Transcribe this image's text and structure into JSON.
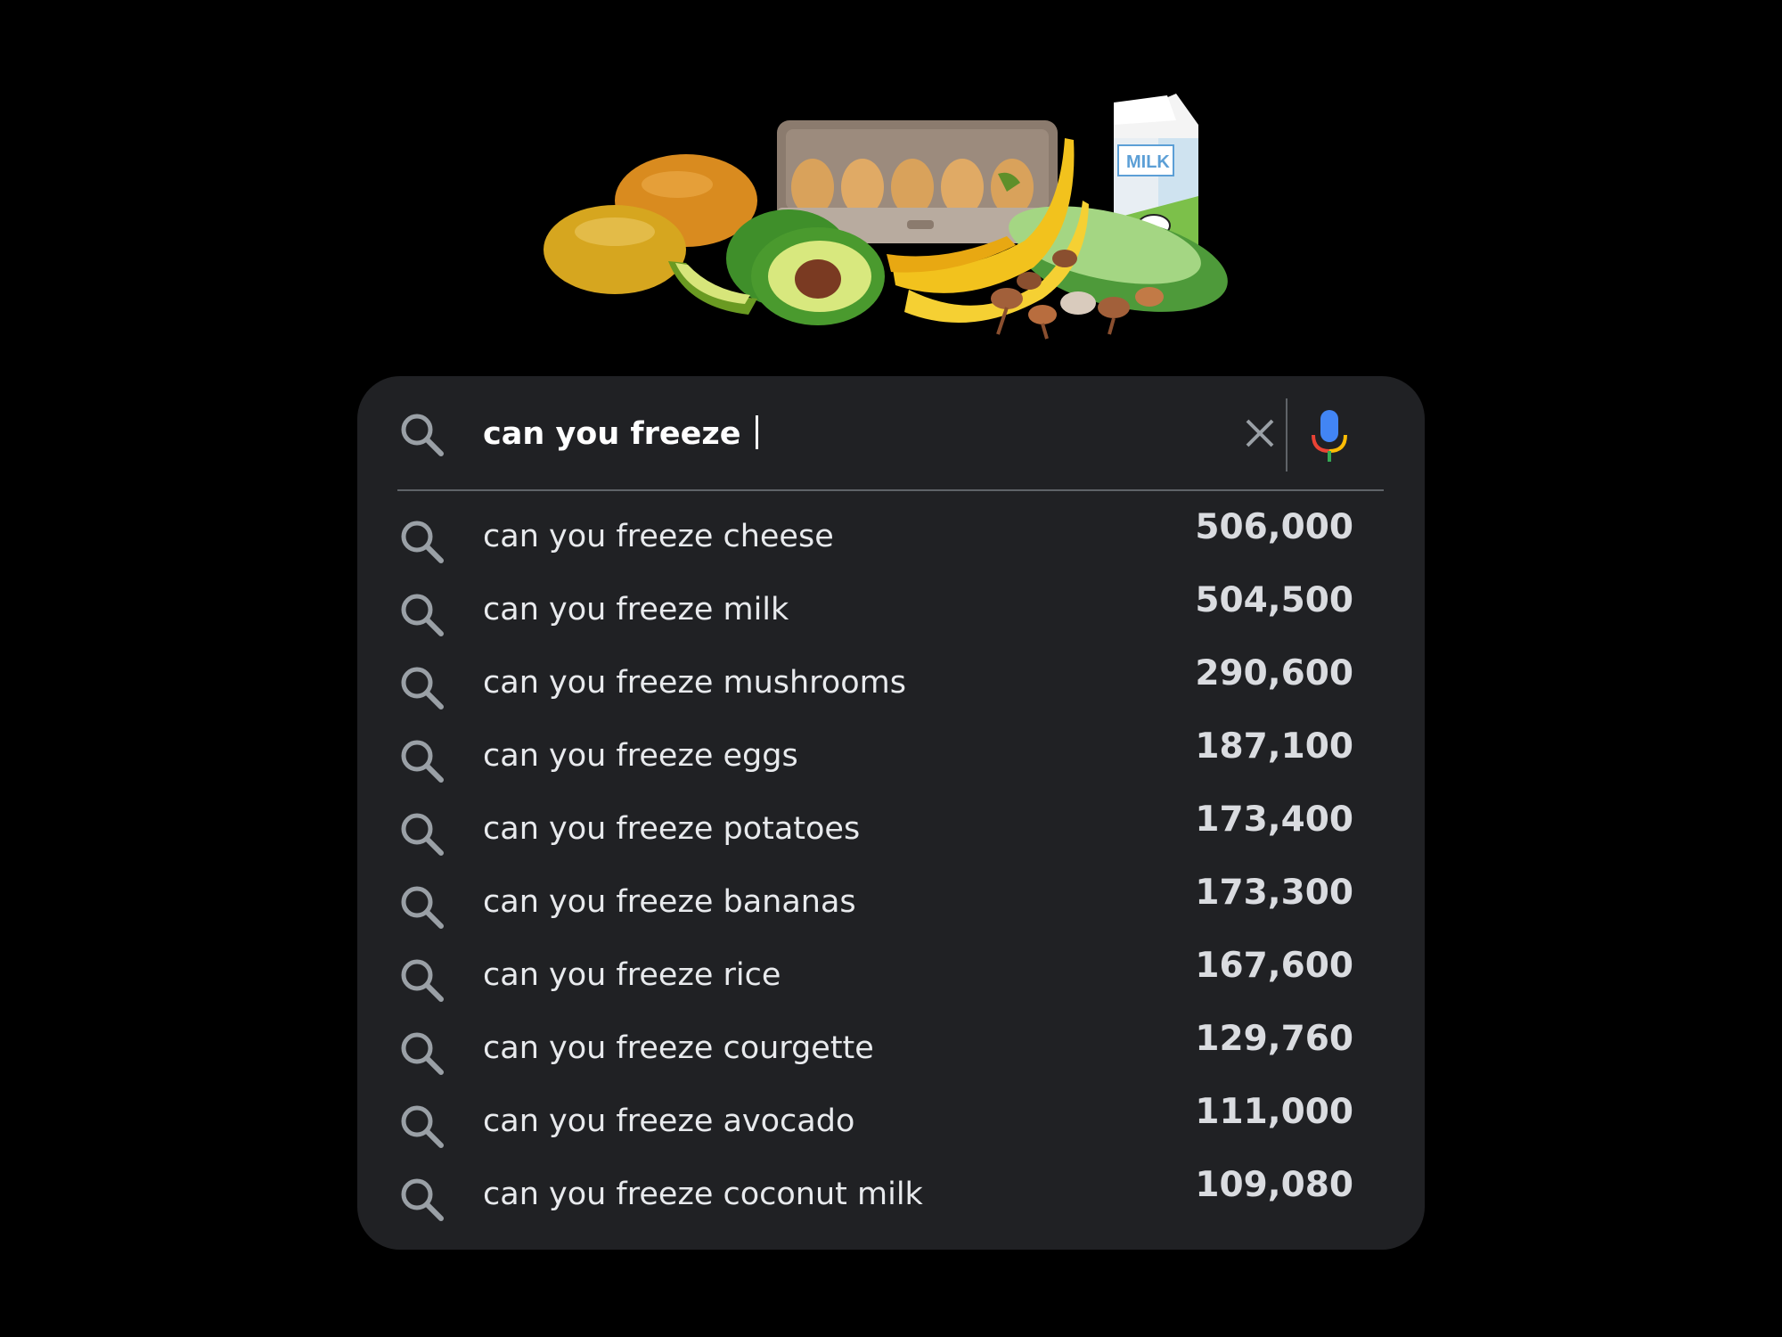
{
  "search": {
    "query": "can you freeze ",
    "clear_icon": "close-icon",
    "mic_icon": "mic-icon"
  },
  "colors": {
    "background": "#000000",
    "panel": "#202124",
    "text": "#e8eaed",
    "icon": "#9aa0a6",
    "mic_blue": "#4285f4",
    "mic_red": "#ea4335",
    "mic_yellow": "#fbbc05",
    "mic_green": "#34a853"
  },
  "suggestions": [
    {
      "text": "can you freeze cheese",
      "count": "506,000"
    },
    {
      "text": "can you freeze milk",
      "count": "504,500"
    },
    {
      "text": "can you freeze mushrooms",
      "count": "290,600"
    },
    {
      "text": "can you freeze eggs",
      "count": "187,100"
    },
    {
      "text": "can you freeze potatoes",
      "count": "173,400"
    },
    {
      "text": "can you freeze bananas",
      "count": "173,300"
    },
    {
      "text": "can you freeze rice",
      "count": "167,600"
    },
    {
      "text": "can you freeze courgette",
      "count": "129,760"
    },
    {
      "text": "can you freeze avocado",
      "count": "111,000"
    },
    {
      "text": "can you freeze coconut milk",
      "count": "109,080"
    }
  ],
  "illustration": {
    "milk_carton_label": "MILK",
    "items": [
      "potato-icon",
      "egg-carton-icon",
      "milk-carton-icon",
      "avocado-icon",
      "banana-icon",
      "courgette-icon",
      "mushroom-icon"
    ]
  }
}
